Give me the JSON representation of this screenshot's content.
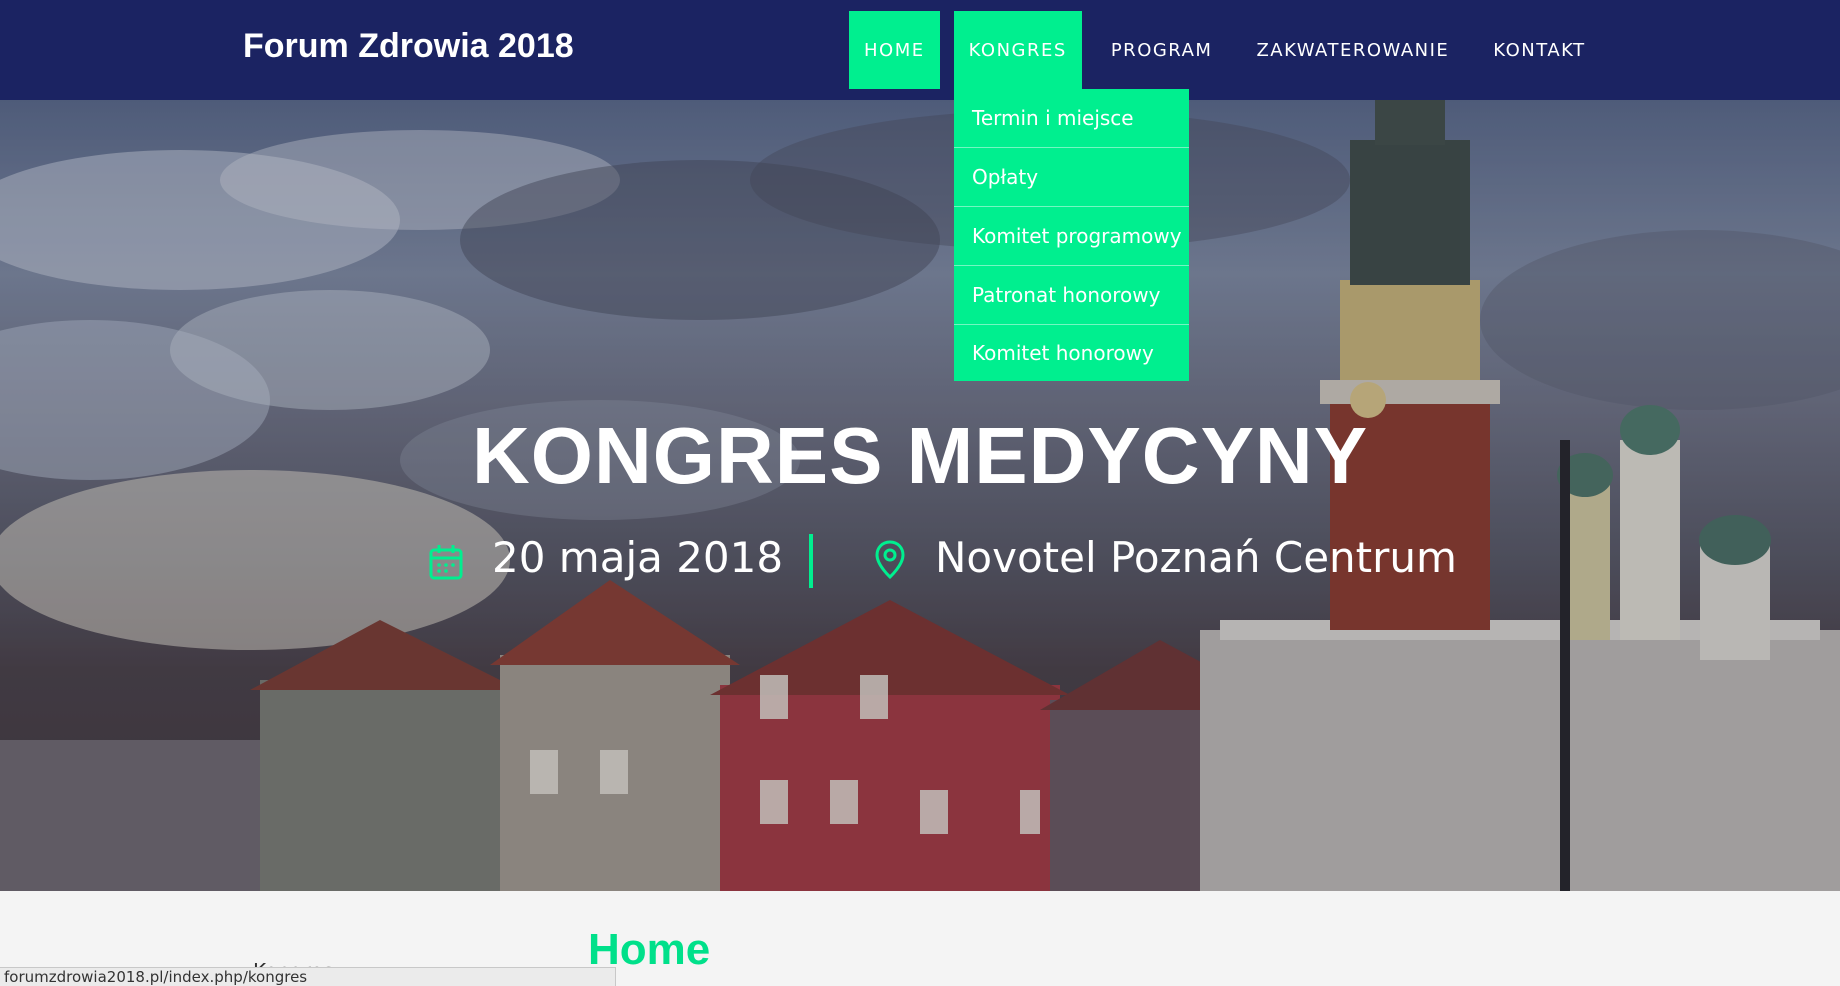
{
  "brand": "Forum Zdrowia 2018",
  "nav": {
    "items": [
      {
        "label": "HOME"
      },
      {
        "label": "KONGRES"
      },
      {
        "label": "PROGRAM"
      },
      {
        "label": "ZAKWATEROWANIE"
      },
      {
        "label": "KONTAKT"
      }
    ]
  },
  "dropdown": {
    "items": [
      {
        "label": "Termin i miejsce"
      },
      {
        "label": "Opłaty"
      },
      {
        "label": "Komitet programowy"
      },
      {
        "label": "Patronat honorowy"
      },
      {
        "label": "Komitet honorowy"
      }
    ]
  },
  "hero": {
    "title": "KONGRES MEDYCYNY",
    "date": "20 maja 2018",
    "location": "Novotel Poznań Centrum",
    "date_icon": "calendar-icon",
    "location_icon": "map-pin-icon"
  },
  "content": {
    "heading": "Home",
    "side_link": "Kongres"
  },
  "status_bar": {
    "url": "forumzdrowia2018.pl/index.php/kongres"
  },
  "colors": {
    "nav_bg": "#1b2362",
    "accent": "#00ef8f",
    "heading": "#00e08a"
  }
}
